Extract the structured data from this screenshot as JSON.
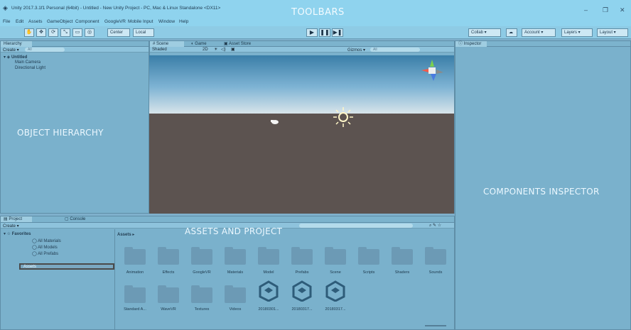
{
  "window": {
    "title": "Unity 2017.3.1f1 Personal (64bit) - Untitled - New Unity Project - PC, Mac & Linux Standalone <DX11>",
    "overlay_label": "TOOLBARS",
    "controls": {
      "minimize": "–",
      "maximize": "❐",
      "close": "✕"
    }
  },
  "menu": [
    "File",
    "Edit",
    "Assets",
    "GameObject",
    "Component",
    "GoogleVR",
    "Mobile Input",
    "Window",
    "Help"
  ],
  "toolbar": {
    "tools": [
      "✋",
      "✥",
      "⟳",
      "⤡",
      "▭",
      "◎"
    ],
    "center_label": "Center",
    "local_label": "Local",
    "play": "▶",
    "pause": "❚❚",
    "step": "▶❚",
    "collab_label": "Collab ▾",
    "cloud_icon": "☁",
    "account_label": "Account ▾",
    "layers_label": "Layers ▾",
    "layout_label": "Layout ▾"
  },
  "hierarchy": {
    "tab": "Hierarchy",
    "create_label": "Create ▾",
    "search_placeholder": "All",
    "scene_name": "Untitled",
    "items": [
      "Main Camera",
      "Directional Light"
    ],
    "overlay_label": "OBJECT HIERARCHY"
  },
  "scene": {
    "tabs": [
      "Scene",
      "Game",
      "Asset Store"
    ],
    "shading": "Shaded",
    "mode_2d": "2D",
    "gizmos_label": "Gizmos ▾",
    "search_placeholder": "All"
  },
  "inspector": {
    "tab": "Inspector",
    "overlay_label": "COMPONENTS INSPECTOR"
  },
  "project": {
    "tabs": [
      "Project",
      "Console"
    ],
    "create_label": "Create ▾",
    "overlay_label": "ASSETS AND PROJECT",
    "favorites_label": "Favorites",
    "favorites": [
      "All Materials",
      "All Models",
      "All Prefabs"
    ],
    "assets_root": "Assets",
    "breadcrumb": "Assets ▸",
    "folders_row1": [
      "Animation",
      "Effects",
      "GoogleVR",
      "Materials",
      "Model",
      "Prefabs",
      "Scene",
      "Scripts",
      "Shaders",
      "Sounds"
    ],
    "folders_row2": [
      "Standard A...",
      "WaveVR",
      "Textures",
      "Videos"
    ],
    "unity_assets": [
      "20180301...",
      "20180317...",
      "20180317..."
    ]
  }
}
